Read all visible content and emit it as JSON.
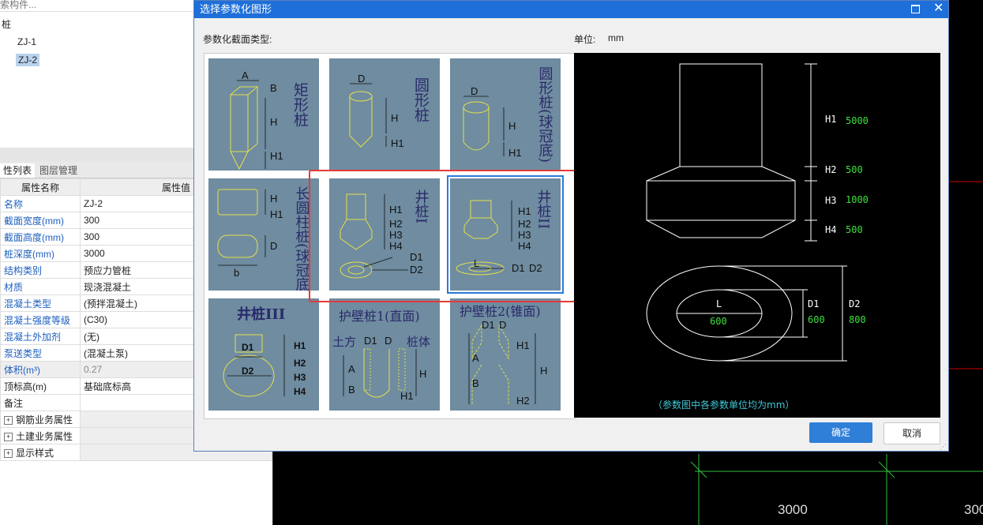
{
  "search": {
    "placeholder_text": "索构件..."
  },
  "tree": {
    "root": "桩",
    "items": [
      "ZJ-1",
      "ZJ-2"
    ]
  },
  "tabs": [
    "性列表",
    "图层管理"
  ],
  "props": {
    "header": [
      "属性名称",
      "属性值"
    ],
    "rows": [
      {
        "name": "名称",
        "value": "ZJ-2"
      },
      {
        "name": "截面宽度(mm)",
        "value": "300"
      },
      {
        "name": "截面高度(mm)",
        "value": "300"
      },
      {
        "name": "桩深度(mm)",
        "value": "3000"
      },
      {
        "name": "结构类别",
        "value": "预应力管桩"
      },
      {
        "name": "材质",
        "value": "现浇混凝土"
      },
      {
        "name": "混凝土类型",
        "value": "(预拌混凝土)"
      },
      {
        "name": "混凝土强度等级",
        "value": "(C30)"
      },
      {
        "name": "混凝土外加剂",
        "value": "(无)"
      },
      {
        "name": "泵送类型",
        "value": "(混凝土泵)"
      },
      {
        "name": "体积(m³)",
        "value": "0.27"
      },
      {
        "name": "顶标高(m)",
        "value": "基础底标高"
      },
      {
        "name": "备注",
        "value": ""
      }
    ],
    "groups": [
      "钢筋业务属性",
      "土建业务属性",
      "显示样式"
    ]
  },
  "dialog": {
    "title": "选择参数化图形",
    "section_label": "参数化截面类型:",
    "unit_label": "单位:",
    "unit_value": "mm",
    "ok": "确定",
    "cancel": "取消"
  },
  "shapes": [
    {
      "title": "矩形桩",
      "params": [
        "A",
        "B",
        "H",
        "H1"
      ]
    },
    {
      "title": "圆形桩",
      "params": [
        "D",
        "H",
        "H1"
      ]
    },
    {
      "title": "圆形桩(球冠底)",
      "params": [
        "D",
        "H",
        "H1"
      ]
    },
    {
      "title": "长圆柱桩(球冠底)",
      "params": [
        "H",
        "H1",
        "D",
        "b"
      ]
    },
    {
      "title": "井桩I",
      "params": [
        "H1",
        "H2",
        "H3",
        "H4",
        "D1",
        "D2"
      ]
    },
    {
      "title": "井桩II",
      "params": [
        "H1",
        "H2",
        "H3",
        "H4",
        "L",
        "D1",
        "D2"
      ]
    },
    {
      "title": "井桩III",
      "params": [
        "D1",
        "D2",
        "H1",
        "H2",
        "H3",
        "H4"
      ]
    },
    {
      "title": "护壁桩1(直面)",
      "params": [
        "土方",
        "D1",
        "D",
        "桩体",
        "A",
        "B",
        "H",
        "H1"
      ]
    },
    {
      "title": "护壁桩2(锥面)",
      "params": [
        "D1",
        "D",
        "H1",
        "A",
        "B",
        "H",
        "H2"
      ]
    }
  ],
  "preview": {
    "params": [
      {
        "label": "H1",
        "value": "5000"
      },
      {
        "label": "H2",
        "value": "500"
      },
      {
        "label": "H3",
        "value": "1000"
      },
      {
        "label": "H4",
        "value": "500"
      },
      {
        "label": "L",
        "value": "600"
      },
      {
        "label": "D1",
        "value": "600"
      },
      {
        "label": "D2",
        "value": "800"
      }
    ],
    "note": "（参数图中各参数单位均为mm）"
  },
  "canvas": {
    "dims": [
      "3000",
      "300"
    ]
  }
}
